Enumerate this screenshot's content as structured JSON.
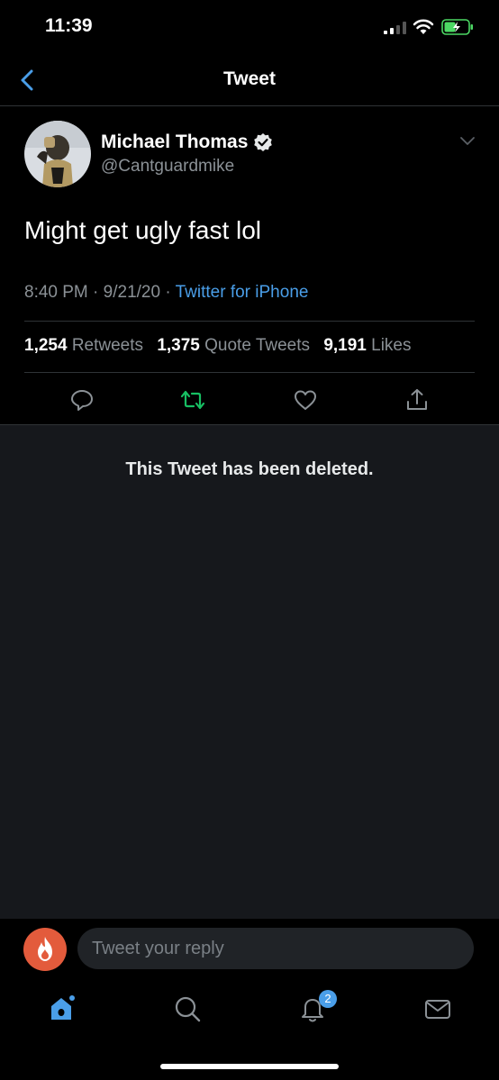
{
  "status_bar": {
    "time": "11:39"
  },
  "nav": {
    "title": "Tweet"
  },
  "tweet": {
    "author_name": "Michael Thomas",
    "author_handle": "@Cantguardmike",
    "text": "Might get ugly fast lol",
    "time": "8:40 PM",
    "date": "9/21/20",
    "source": "Twitter for iPhone",
    "stats": {
      "retweets_count": "1,254",
      "retweets_label": "Retweets",
      "quotes_count": "1,375",
      "quotes_label": "Quote Tweets",
      "likes_count": "9,191",
      "likes_label": "Likes"
    }
  },
  "deleted_notice": "This Tweet has been deleted.",
  "reply": {
    "placeholder": "Tweet your reply"
  },
  "tabbar": {
    "notifications_badge": "2"
  },
  "colors": {
    "accent": "#4a9ee8",
    "retweet_green": "#17bf63",
    "muted": "#8b9196",
    "background": "#000000"
  },
  "icons": [
    "back-chevron-icon",
    "verified-badge-icon",
    "chevron-down-icon",
    "reply-icon",
    "retweet-icon",
    "like-icon",
    "share-icon",
    "home-icon",
    "search-icon",
    "bell-icon",
    "mail-icon"
  ]
}
